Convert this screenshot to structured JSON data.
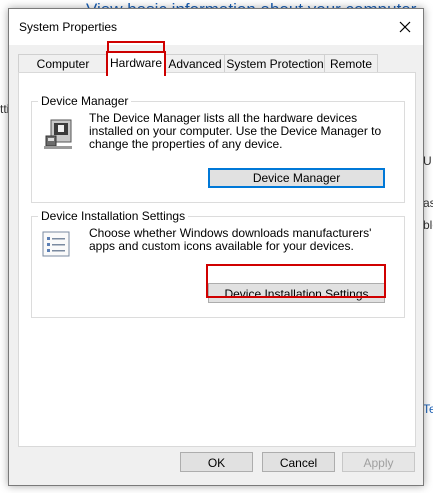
{
  "background": {
    "heading": "View basic information about your computer",
    "frag_left": "tti",
    "frag_right_1": "U @",
    "frag_right_2": "ble",
    "frag_right_3": "ase",
    "frag_right_4": "Te"
  },
  "dialog": {
    "title": "System Properties",
    "tabs": [
      "Computer Name",
      "Hardware",
      "Advanced",
      "System Protection",
      "Remote"
    ],
    "active_tab": "Hardware",
    "device_manager": {
      "group_title": "Device Manager",
      "description": "The Device Manager lists all the hardware devices installed on your computer. Use the Device Manager to change the properties of any device.",
      "button": "Device Manager"
    },
    "device_installation": {
      "group_title": "Device Installation Settings",
      "description": "Choose whether Windows downloads manufacturers' apps and custom icons available for your devices.",
      "button": "Device Installation Settings"
    },
    "footer": {
      "ok": "OK",
      "cancel": "Cancel",
      "apply": "Apply"
    }
  },
  "colors": {
    "highlight": "#d00000",
    "focus_border": "#0078d7",
    "link": "#1a5fb4"
  }
}
